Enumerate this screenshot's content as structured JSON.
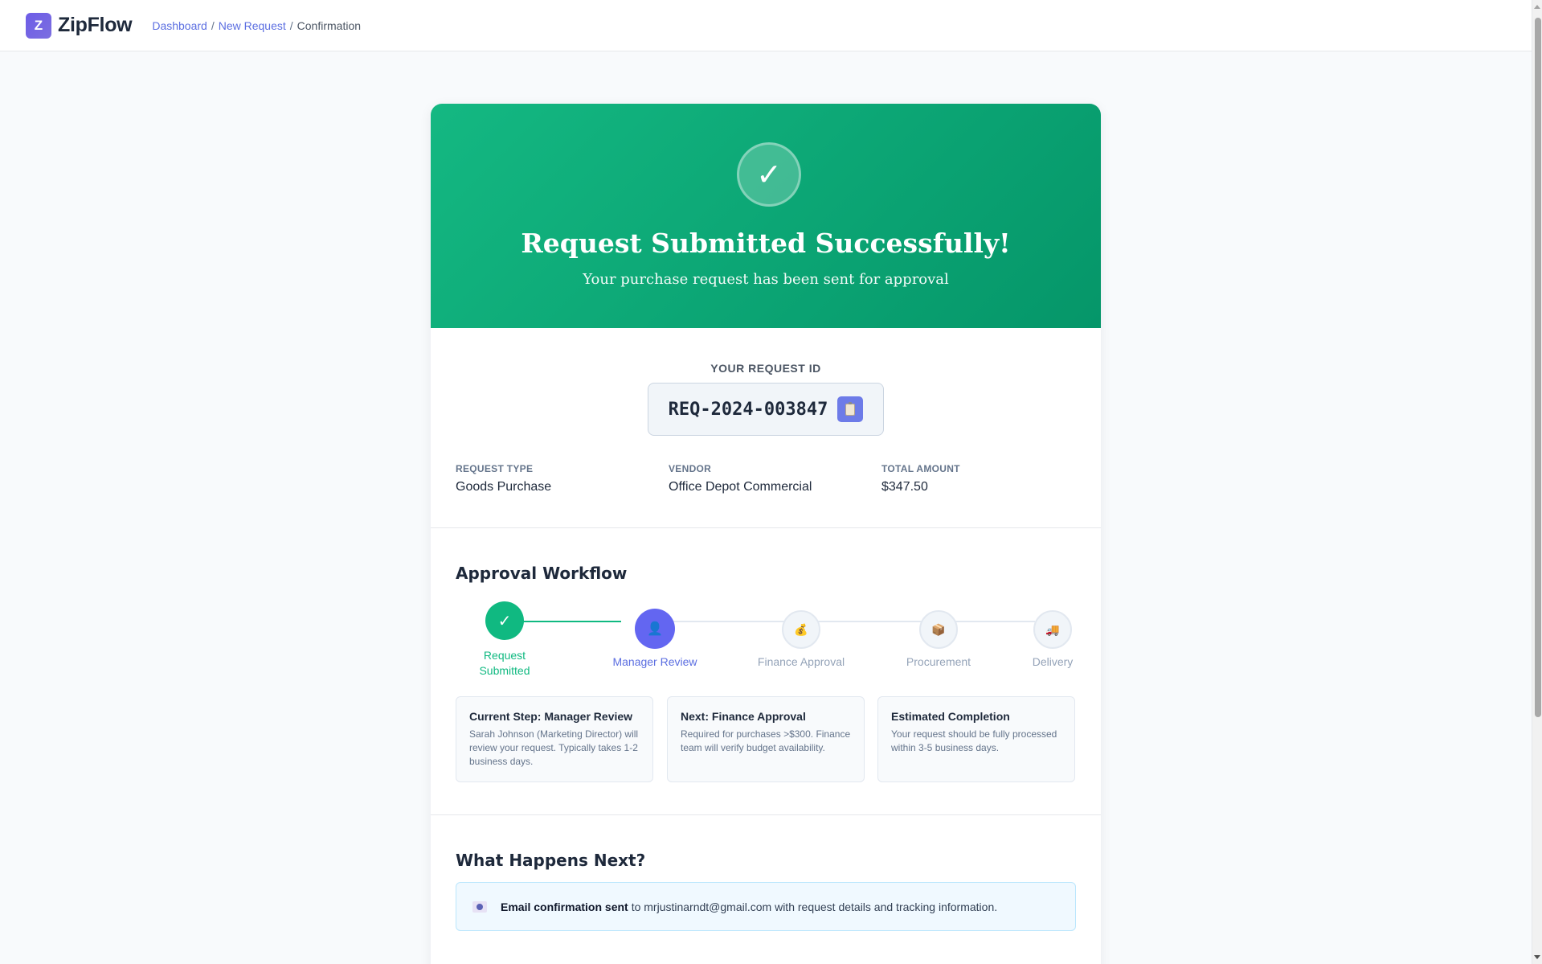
{
  "brand": {
    "logo_letter": "Z",
    "name": "ZipFlow"
  },
  "breadcrumb": {
    "items": [
      "Dashboard",
      "New Request"
    ],
    "current": "Confirmation",
    "sep": "/"
  },
  "hero": {
    "icon": "checkmark-icon",
    "check_glyph": "✓",
    "title": "Request Submitted Successfully!",
    "subtitle": "Your purchase request has been sent for approval"
  },
  "request": {
    "id_label": "YOUR REQUEST ID",
    "id": "REQ-2024-003847",
    "copy_icon": "clipboard-icon",
    "fields": [
      {
        "label": "REQUEST TYPE",
        "value": "Goods Purchase"
      },
      {
        "label": "VENDOR",
        "value": "Office Depot Commercial"
      },
      {
        "label": "TOTAL AMOUNT",
        "value": "$347.50"
      }
    ]
  },
  "workflow": {
    "title": "Approval Workflow",
    "steps": [
      {
        "label": "Request Submitted",
        "state": "complete",
        "icon": "check-icon",
        "glyph": "✓"
      },
      {
        "label": "Manager Review",
        "state": "current",
        "icon": "person-icon",
        "glyph": "👤"
      },
      {
        "label": "Finance Approval",
        "state": "pending",
        "icon": "money-bag-icon",
        "glyph": "💰"
      },
      {
        "label": "Procurement",
        "state": "pending",
        "icon": "package-icon",
        "glyph": "📦"
      },
      {
        "label": "Delivery",
        "state": "pending",
        "icon": "truck-icon",
        "glyph": "🚚"
      }
    ],
    "info": [
      {
        "title": "Current Step: Manager Review",
        "body": "Sarah Johnson (Marketing Director) will review your request. Typically takes 1-2 business days."
      },
      {
        "title": "Next: Finance Approval",
        "body": "Required for purchases >$300. Finance team will verify budget availability."
      },
      {
        "title": "Estimated Completion",
        "body": "Your request should be fully processed within 3-5 business days."
      }
    ]
  },
  "next": {
    "title": "What Happens Next?",
    "email_icon": "envelope-icon",
    "email_strong": "Email confirmation sent",
    "email_rest": "to mrjustinarndt@gmail.com with request details and tracking information."
  },
  "colors": {
    "success": "#10b981",
    "primary": "#6366f1",
    "pending": "#94a3b8"
  }
}
